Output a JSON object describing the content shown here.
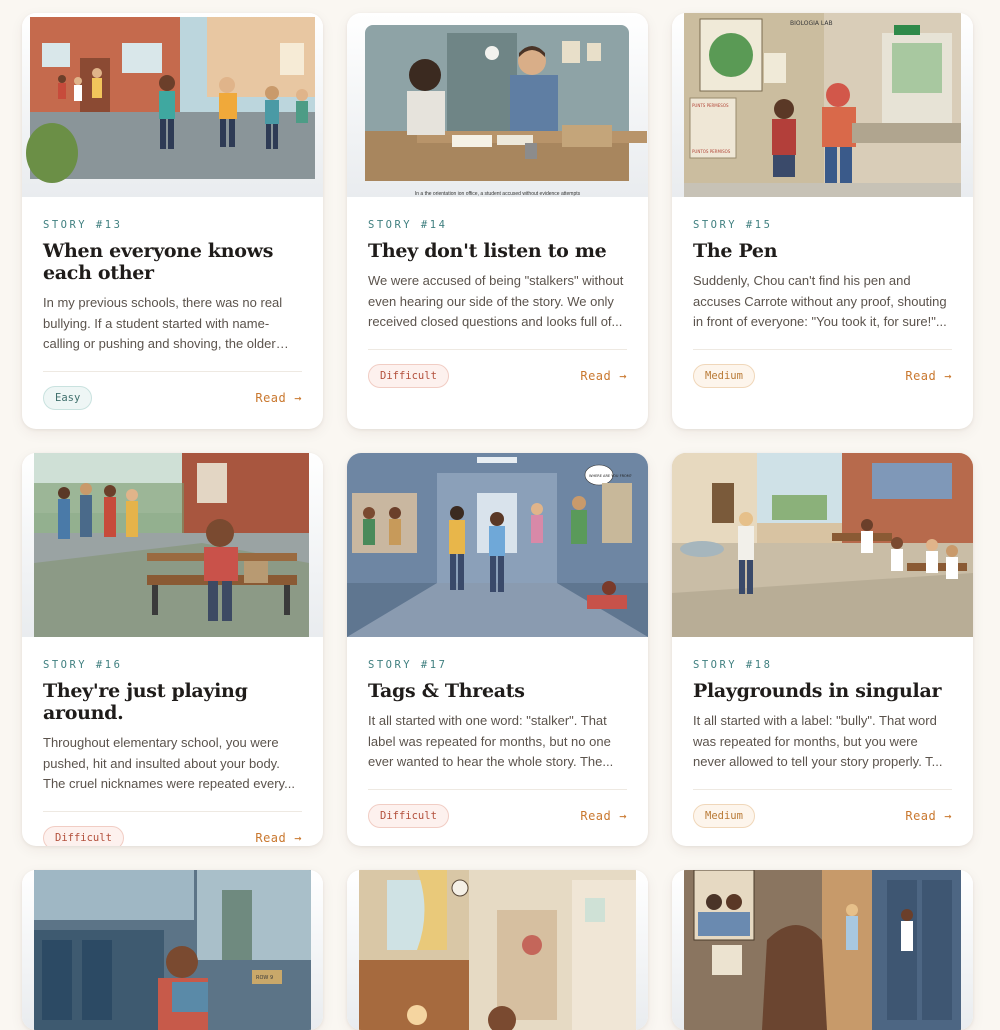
{
  "cards": [
    {
      "number": "STORY #13",
      "title": "When everyone knows each other",
      "excerpt": "In my previous schools, there was no real bullying. If a student started with name-calling or pushing and shoving, the older students would step in...",
      "difficulty": "Easy",
      "read_label": "Read",
      "image_name": "schoolyard-illustration"
    },
    {
      "number": "STORY #14",
      "title": "They don't listen to me",
      "excerpt": "We were accused of being \"stalkers\" without even hearing our side of the story. We only received closed questions and looks full of...",
      "difficulty": "Difficult",
      "read_label": "Read",
      "image_name": "orientation-office-illustration",
      "image_caption": "In a the orientation ion office, a student accused without evidence attempts"
    },
    {
      "number": "STORY #15",
      "title": "The Pen",
      "excerpt": "Suddenly, Chou can't find his pen and accuses Carrote without any proof, shouting in front of everyone: \"You took it, for sure!\"...",
      "difficulty": "Medium",
      "read_label": "Read",
      "image_name": "biology-lab-illustration",
      "image_texts": [
        "BIOLOGIA LAB",
        "PUNTS PERMESOS",
        "PUNTOS PERMISOS"
      ]
    },
    {
      "number": "STORY #16",
      "title": "They're just playing around.",
      "excerpt": "Throughout elementary school, you were pushed, hit and insulted about your body. The cruel nicknames were repeated every...",
      "difficulty": "Difficult",
      "read_label": "Read",
      "image_name": "bench-alone-illustration"
    },
    {
      "number": "STORY #17",
      "title": "Tags & Threats",
      "excerpt": "It all started with one word: \"stalker\". That label was repeated for months, but no one ever wanted to hear the whole story. The...",
      "difficulty": "Difficult",
      "read_label": "Read",
      "image_name": "hallway-illustration",
      "image_texts": [
        "WHERE ARE YOU FROM?"
      ]
    },
    {
      "number": "STORY #18",
      "title": "Playgrounds in singular",
      "excerpt": "It all started with a label: \"bully\". That word was repeated for months, but you were never allowed to tell your story properly. T...",
      "difficulty": "Medium",
      "read_label": "Read",
      "image_name": "courtyard-illustration"
    },
    {
      "image_name": "bus-illustration",
      "image_texts": [
        "ROW 9"
      ]
    },
    {
      "image_name": "kitchen-illustration"
    },
    {
      "image_name": "locker-hallway-illustration"
    }
  ]
}
